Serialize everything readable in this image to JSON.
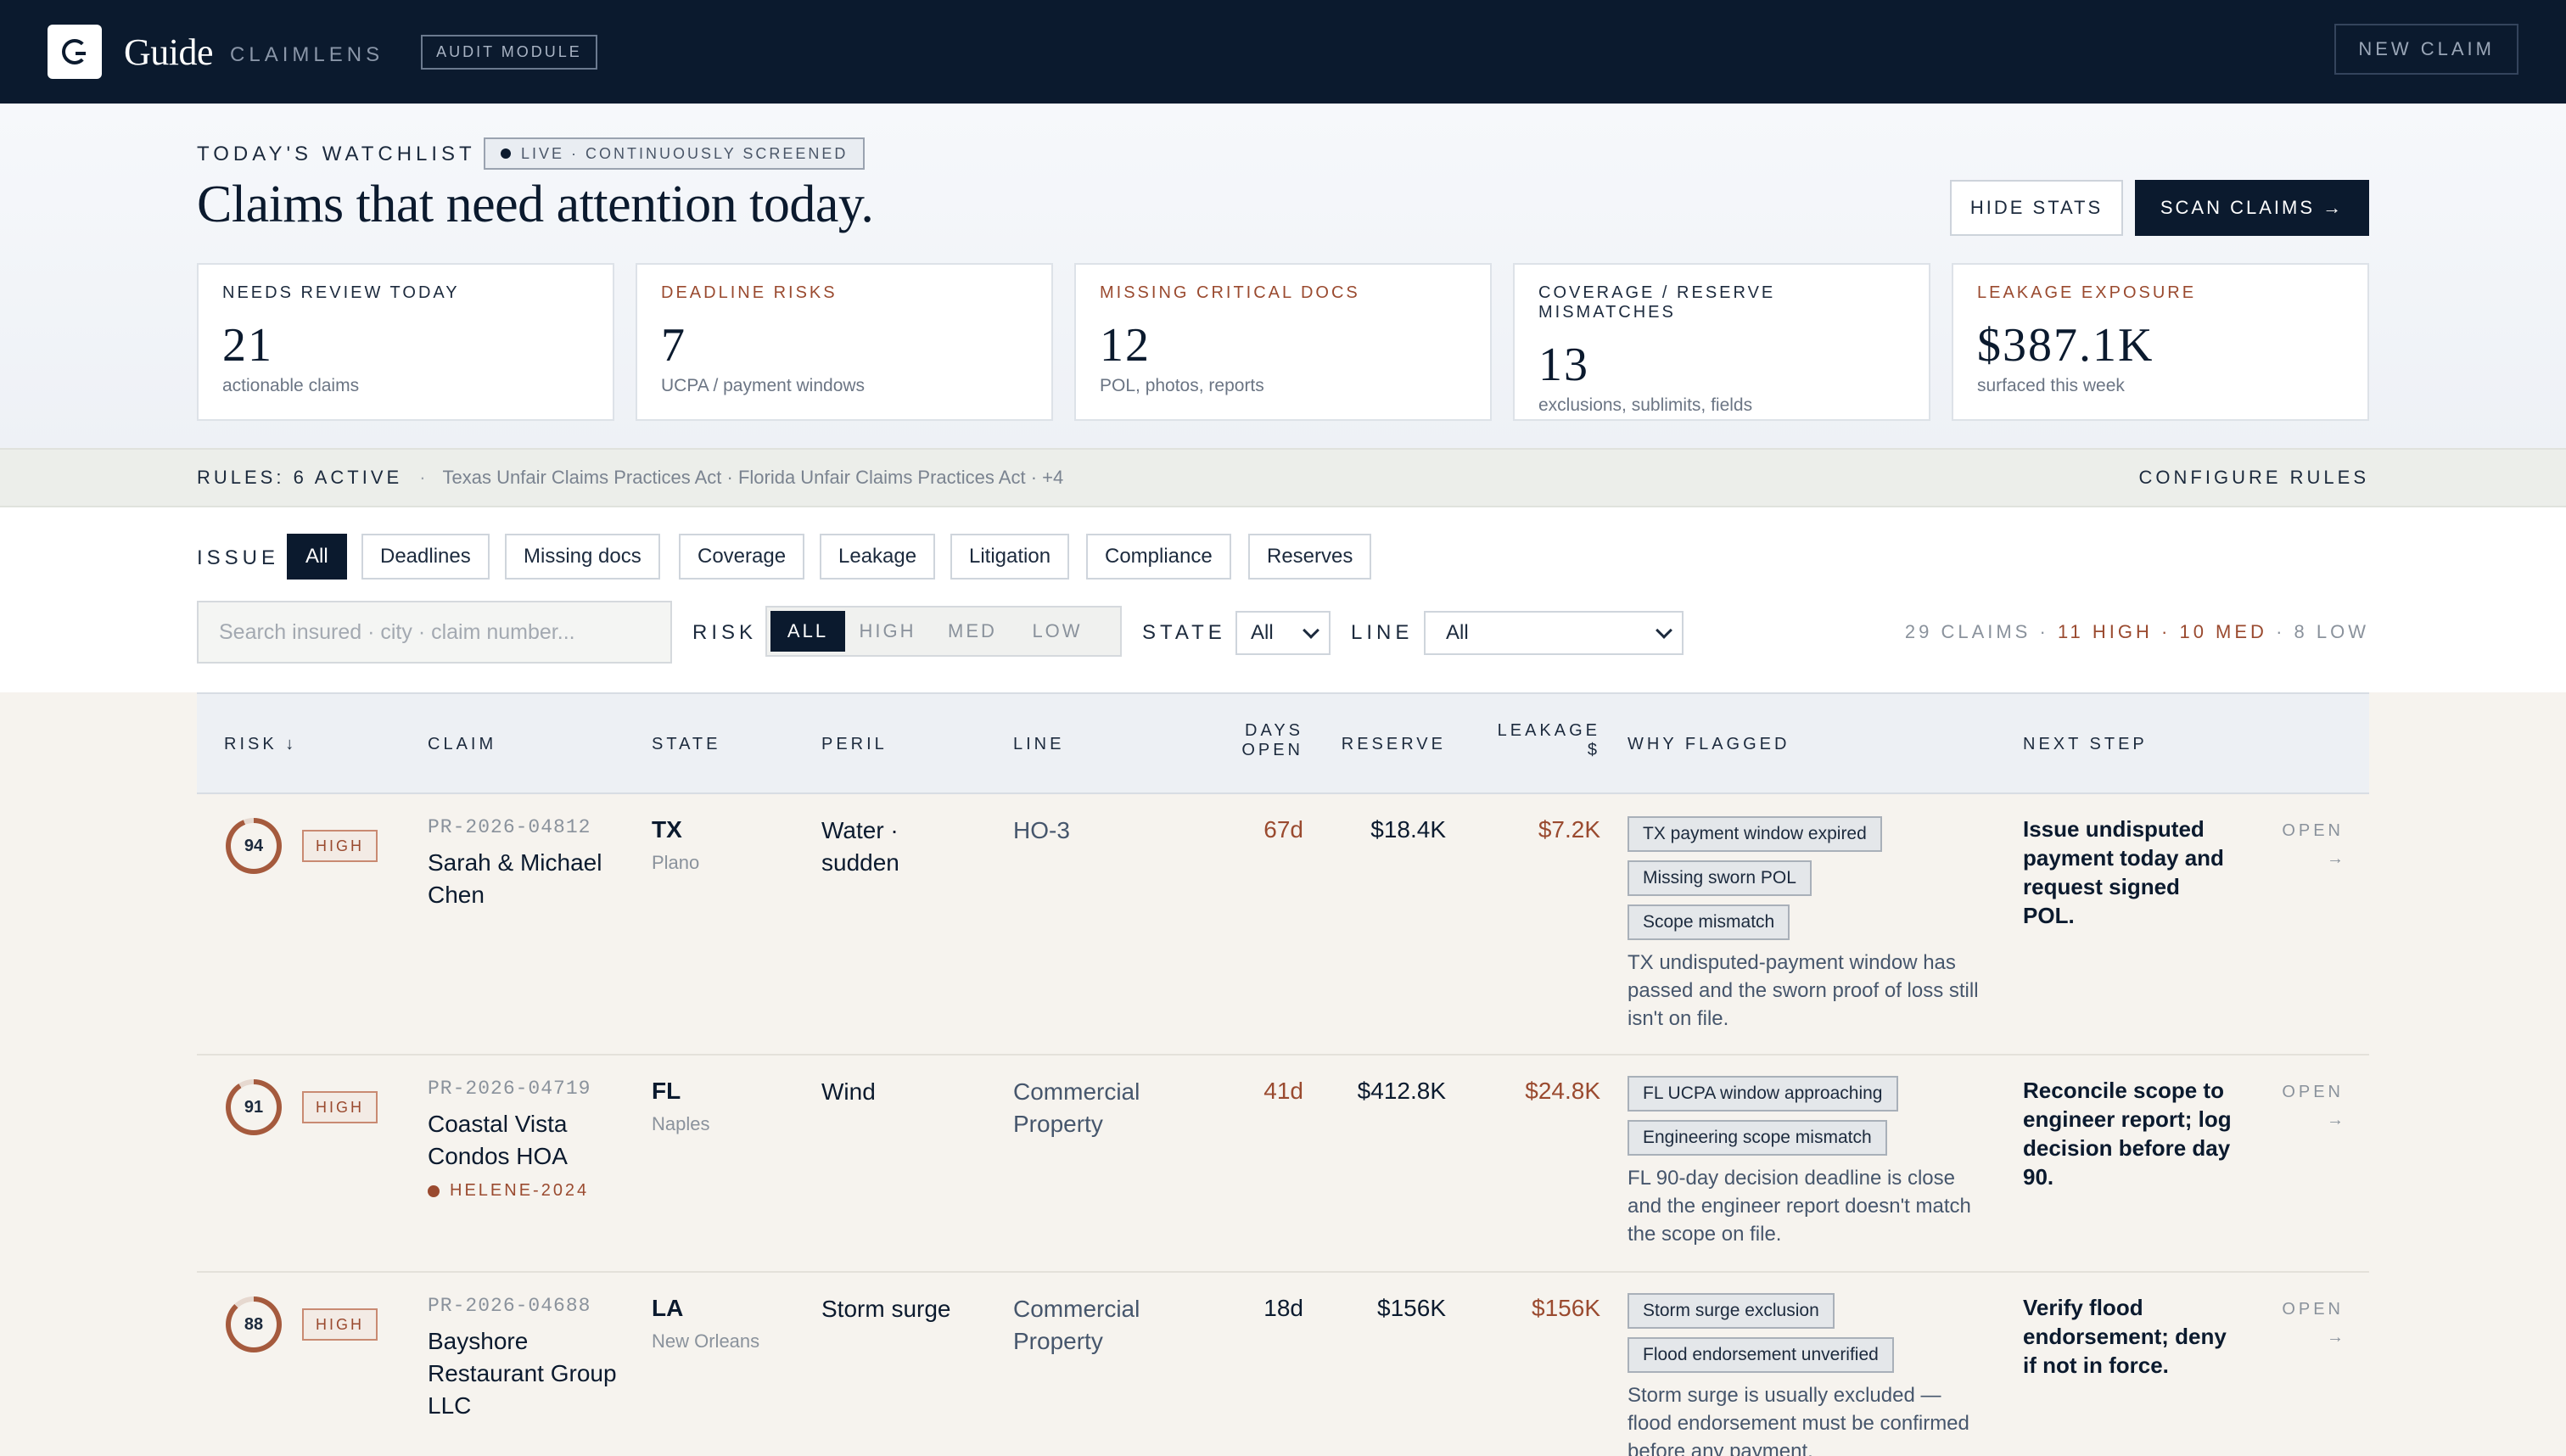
{
  "header": {
    "brand": "Guide",
    "product": "CLAIMLENS",
    "module": "AUDIT MODULE",
    "new_claim": "NEW CLAIM"
  },
  "watchlist": {
    "eyebrow": "TODAY'S WATCHLIST",
    "live": "LIVE · CONTINUOUSLY SCREENED",
    "headline": "Claims that need attention today.",
    "hide_stats": "HIDE STATS",
    "scan_claims": "SCAN CLAIMS →",
    "stats": [
      {
        "label": "NEEDS REVIEW TODAY",
        "value": "21",
        "sub": "actionable claims"
      },
      {
        "label": "DEADLINE RISKS",
        "value": "7",
        "sub": "UCPA / payment windows"
      },
      {
        "label": "MISSING CRITICAL DOCS",
        "value": "12",
        "sub": "POL, photos, reports"
      },
      {
        "label": "COVERAGE / RESERVE MISMATCHES",
        "value": "13",
        "sub": "exclusions, sublimits, fields"
      },
      {
        "label": "LEAKAGE EXPOSURE",
        "value": "$387.1K",
        "sub": "surfaced this week"
      }
    ]
  },
  "rules": {
    "label": "RULES: 6 ACTIVE",
    "sep": "·",
    "list": "Texas Unfair Claims Practices Act · Florida Unfair Claims Practices Act · +4",
    "configure": "CONFIGURE RULES"
  },
  "filters": {
    "issue_label": "ISSUE",
    "issues": [
      "All",
      "Deadlines",
      "Missing docs",
      "Coverage",
      "Leakage",
      "Litigation",
      "Compliance",
      "Reserves"
    ],
    "search_placeholder": "Search insured · city · claim number...",
    "risk_label": "RISK",
    "risk_options": [
      "ALL",
      "HIGH",
      "MED",
      "LOW"
    ],
    "state_label": "STATE",
    "state_value": "All",
    "line_label": "LINE",
    "line_value": "All",
    "count_total": "29 CLAIMS",
    "count_sep": "·",
    "count_high": "11 HIGH",
    "count_med": "10 MED",
    "count_low": "8 LOW"
  },
  "table": {
    "headers": {
      "risk": "RISK ↓",
      "claim": "CLAIM",
      "state": "STATE",
      "peril": "PERIL",
      "line": "LINE",
      "days_1": "DAYS",
      "days_2": "OPEN",
      "reserve": "RESERVE",
      "leakage_1": "LEAKAGE",
      "leakage_2": "$",
      "why": "WHY FLAGGED",
      "next": "NEXT STEP"
    },
    "rows": [
      {
        "score": "94",
        "score_pct": 94,
        "level": "HIGH",
        "id": "PR-2026-04812",
        "name": "Sarah & Michael Chen",
        "state": "TX",
        "city": "Plano",
        "peril": "Water · sudden",
        "line": "HO-3",
        "days": "67d",
        "reserve": "$18.4K",
        "leakage": "$7.2K",
        "tags": [
          "TX payment window expired",
          "Missing sworn POL",
          "Scope mismatch"
        ],
        "why": "TX undisputed-payment window has passed and the sworn proof of loss still isn't on file.",
        "next": "Issue undisputed payment today and request signed POL.",
        "open": "OPEN",
        "arrow": "→"
      },
      {
        "score": "91",
        "score_pct": 91,
        "level": "HIGH",
        "id": "PR-2026-04719",
        "name": "Coastal Vista Condos HOA",
        "event": "HELENE-2024",
        "state": "FL",
        "city": "Naples",
        "peril": "Wind",
        "line": "Commercial Property",
        "days": "41d",
        "reserve": "$412.8K",
        "leakage": "$24.8K",
        "tags": [
          "FL UCPA window approaching",
          "Engineering scope mismatch"
        ],
        "why": "FL 90-day decision deadline is close and the engineer report doesn't match the scope on file.",
        "next": "Reconcile scope to engineer report; log decision before day 90.",
        "open": "OPEN",
        "arrow": "→"
      },
      {
        "score": "88",
        "score_pct": 88,
        "level": "HIGH",
        "id": "PR-2026-04688",
        "name": "Bayshore Restaurant Group LLC",
        "state": "LA",
        "city": "New Orleans",
        "peril": "Storm surge",
        "line": "Commercial Property",
        "days": "18d",
        "reserve": "$156K",
        "leakage": "$156K",
        "tags": [
          "Storm surge exclusion",
          "Flood endorsement unverified"
        ],
        "why": "Storm surge is usually excluded — flood endorsement must be confirmed before any payment.",
        "next": "Verify flood endorsement; deny if not in force.",
        "open": "OPEN",
        "arrow": "→"
      }
    ]
  },
  "colors": {
    "navy": "#0b1a2e",
    "rust": "#9a4a2f",
    "ring": "#a55a3d"
  }
}
